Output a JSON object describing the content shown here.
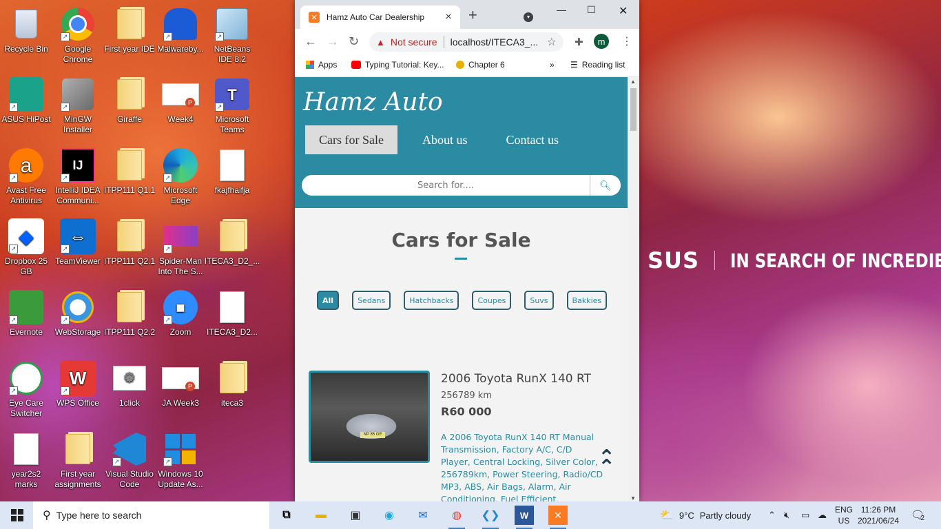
{
  "desktop": {
    "brand_logo": "SUS",
    "brand_tagline": "IN SEARCH OF INCREDIBLE",
    "icons": [
      {
        "label": "Recycle Bin"
      },
      {
        "label": "Google Chrome"
      },
      {
        "label": "First year IDE"
      },
      {
        "label": "Malwareby..."
      },
      {
        "label": "NetBeans IDE 8.2"
      },
      {
        "label": "ASUS HiPost"
      },
      {
        "label": "MinGW Installer"
      },
      {
        "label": "Giraffe"
      },
      {
        "label": "Week4"
      },
      {
        "label": "Microsoft Teams"
      },
      {
        "label": "Avast Free Antivirus"
      },
      {
        "label": "IntelliJ IDEA Communi..."
      },
      {
        "label": "ITPP111 Q1.1"
      },
      {
        "label": "Microsoft Edge"
      },
      {
        "label": "fkajfhaifja"
      },
      {
        "label": "Dropbox 25 GB"
      },
      {
        "label": "TeamViewer"
      },
      {
        "label": "ITPP111 Q2.1"
      },
      {
        "label": "Spider-Man Into The S..."
      },
      {
        "label": "ITECA3_D2_..."
      },
      {
        "label": "Evernote"
      },
      {
        "label": "WebStorage"
      },
      {
        "label": "ITPP111 Q2.2"
      },
      {
        "label": "Zoom"
      },
      {
        "label": "ITECA3_D2..."
      },
      {
        "label": "Eye Care Switcher"
      },
      {
        "label": "WPS Office"
      },
      {
        "label": "1click"
      },
      {
        "label": "JA Week3"
      },
      {
        "label": "iteca3"
      },
      {
        "label": "year2s2 marks"
      },
      {
        "label": "First year assignments"
      },
      {
        "label": "Visual Studio Code"
      },
      {
        "label": "Windows 10 Update As..."
      }
    ]
  },
  "browser": {
    "tab_title": "Hamz Auto Car Dealership",
    "security_label": "Not secure",
    "url": "localhost/ITECA3_...",
    "profile_initial": "m",
    "bookmarks": {
      "apps": "Apps",
      "typing": "Typing Tutorial: Key...",
      "chapter": "Chapter 6",
      "more": "»",
      "reading_list": "Reading list"
    }
  },
  "site": {
    "logo": "Hamz Auto",
    "nav": [
      "Cars for Sale",
      "About us",
      "Contact us"
    ],
    "search_placeholder": "Search for....",
    "section_title": "Cars for Sale",
    "filters": [
      "All",
      "Sedans",
      "Hatchbacks",
      "Coupes",
      "Suvs",
      "Bakkies"
    ],
    "active_filter": "All",
    "car": {
      "name": "2006 Toyota RunX 140 RT",
      "km": "256789 km",
      "price": "R60 000",
      "plate": "NP 85 GE",
      "description": "A 2006 Toyota RunX 140 RT Manual Transmission, Factory A/C, C/D Player, Central Locking, Silver Color, 256789km, Power Steering, Radio/CD MP3, ABS, Air Bags, Alarm, Air Conditioning, Fuel Efficient,"
    }
  },
  "taskbar": {
    "search_placeholder": "Type here to search",
    "weather_temp": "9°C",
    "weather_text": "Partly cloudy",
    "lang_top": "ENG",
    "lang_bottom": "US",
    "time": "11:26 PM",
    "date": "2021/06/24",
    "notification_count": "2"
  },
  "colors": {
    "site_primary": "#2b8ba3",
    "not_secure": "#c5221f",
    "taskbar": "#dce6f4"
  }
}
